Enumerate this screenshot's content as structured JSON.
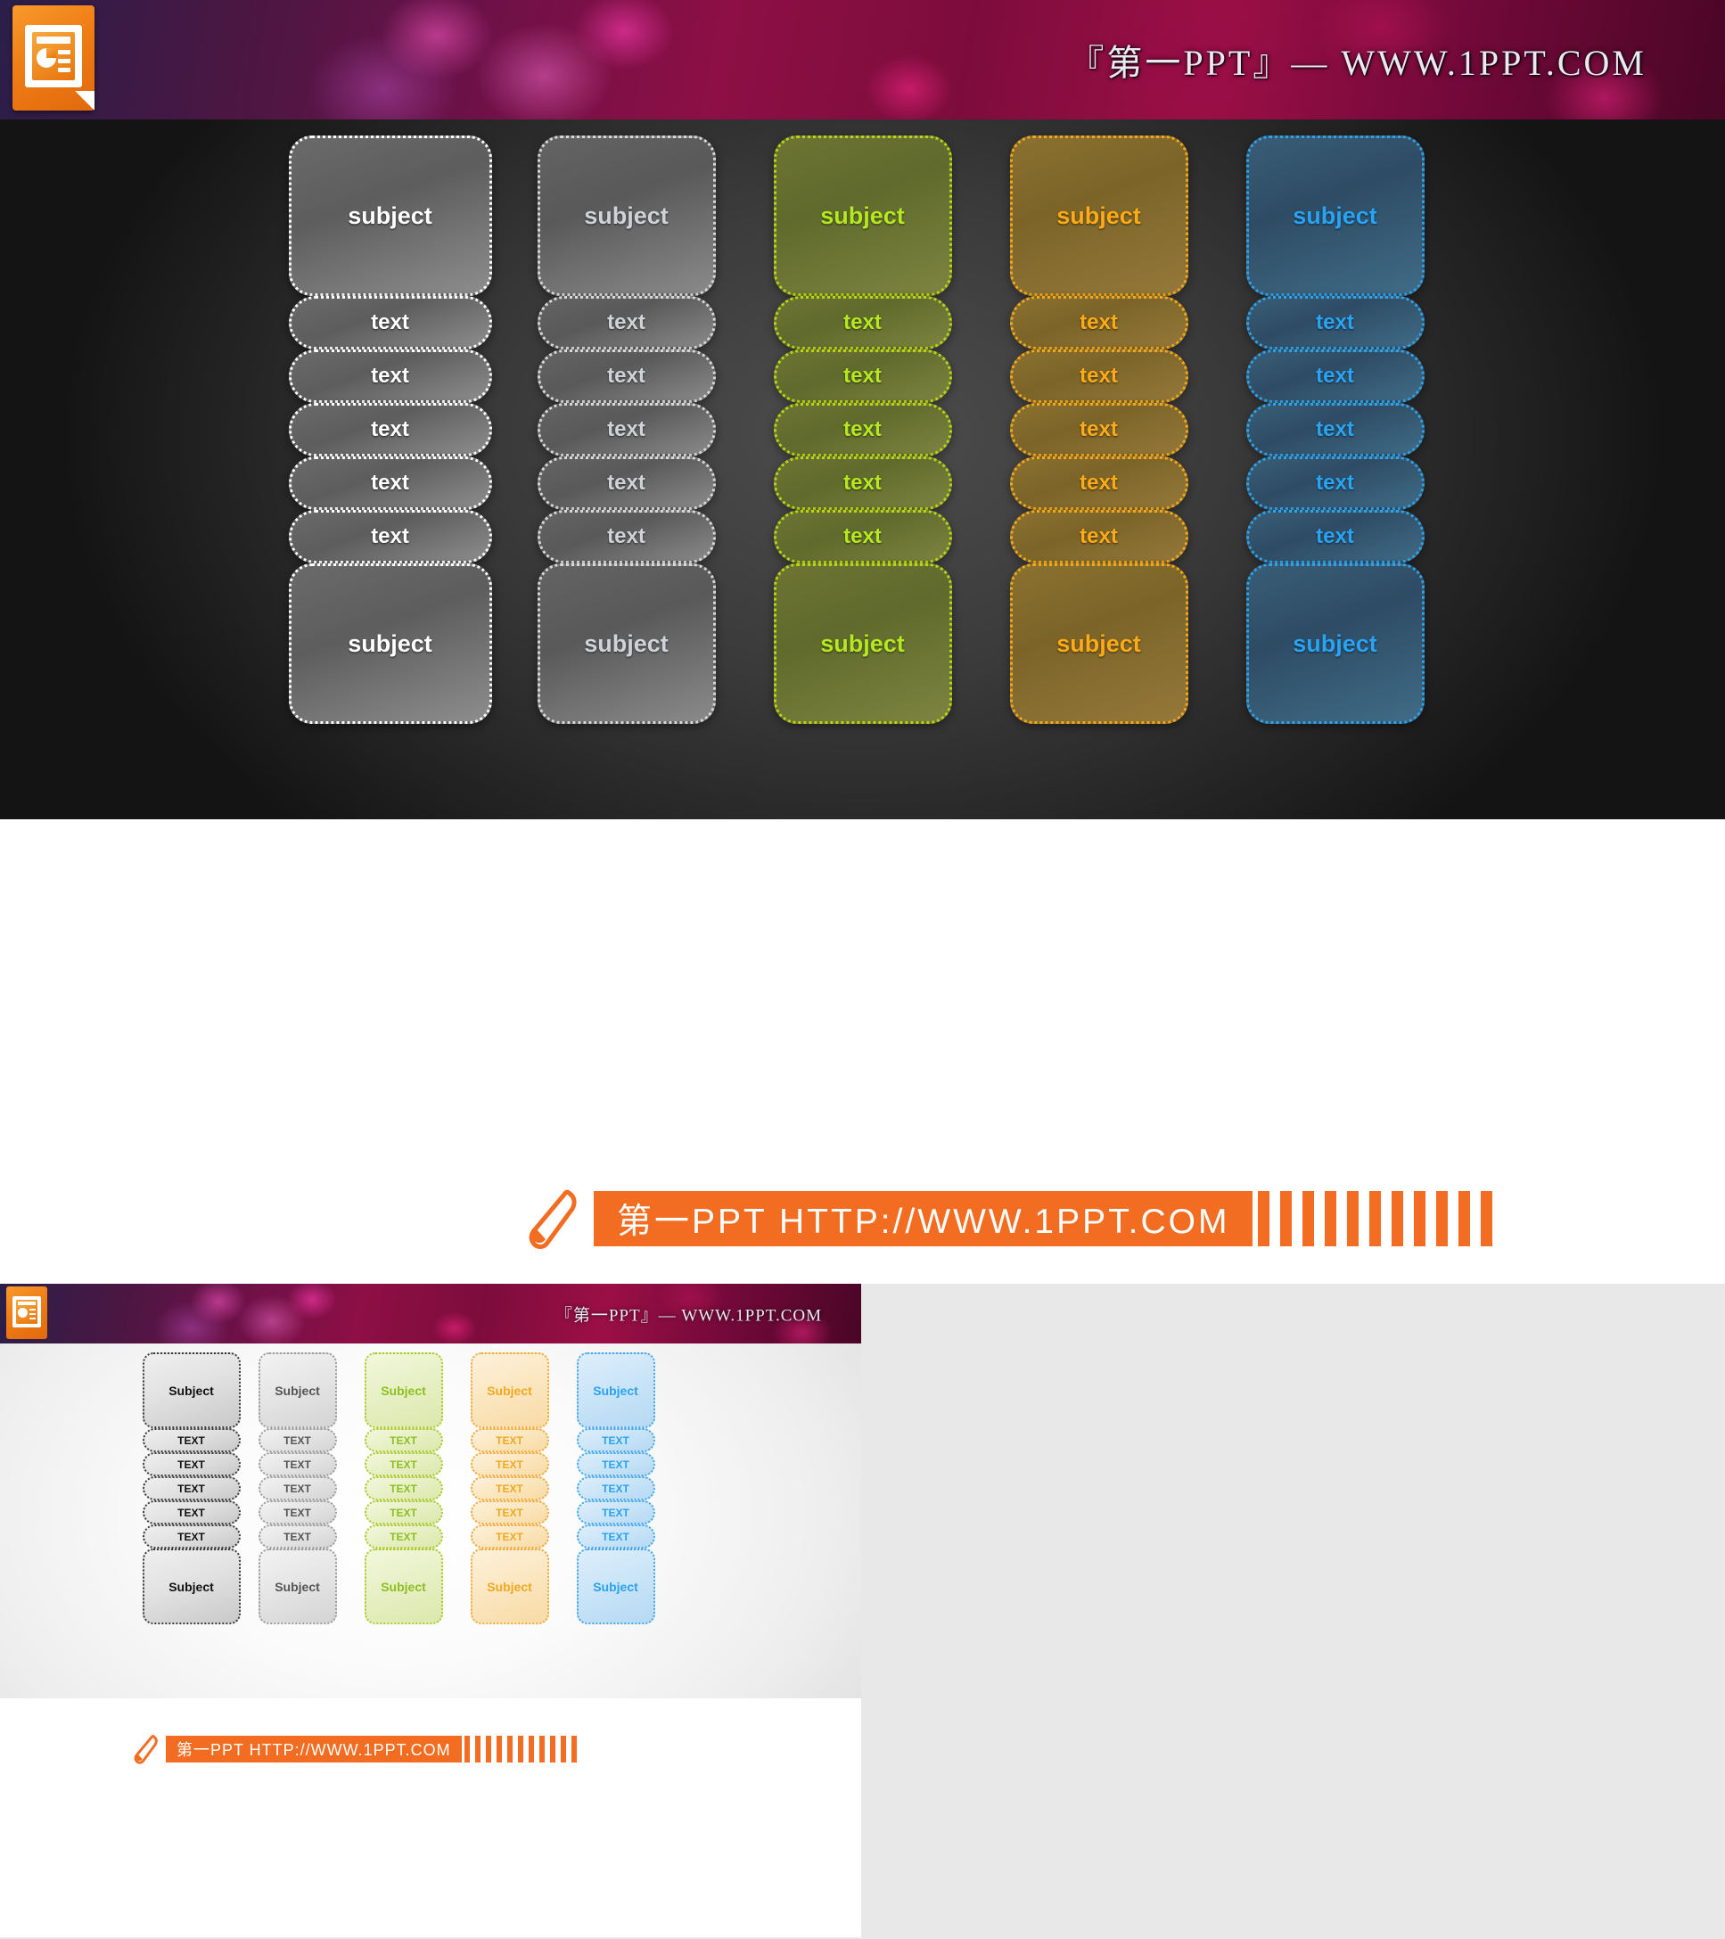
{
  "slide_main": {
    "banner": {
      "logo_icon": "powerpoint-logo-icon",
      "title": "『第一PPT』— WWW.1PPT.COM"
    },
    "grid": {
      "columns": [
        {
          "key": "gray1",
          "theme": "t-gray1",
          "narrow": false
        },
        {
          "key": "gray2",
          "theme": "t-gray2",
          "narrow": true
        },
        {
          "key": "green",
          "theme": "t-green",
          "narrow": true
        },
        {
          "key": "orange",
          "theme": "t-orange",
          "narrow": true
        },
        {
          "key": "blue",
          "theme": "t-blue",
          "narrow": true
        }
      ],
      "rows": [
        {
          "type": "subject",
          "labels": [
            "subject",
            "subject",
            "subject",
            "subject",
            "subject"
          ]
        },
        {
          "type": "text",
          "labels": [
            "text",
            "text",
            "text",
            "text",
            "text"
          ]
        },
        {
          "type": "text",
          "labels": [
            "text",
            "text",
            "text",
            "text",
            "text"
          ]
        },
        {
          "type": "text",
          "labels": [
            "text",
            "text",
            "text",
            "text",
            "text"
          ]
        },
        {
          "type": "text",
          "labels": [
            "text",
            "text",
            "text",
            "text",
            "text"
          ]
        },
        {
          "type": "text",
          "labels": [
            "text",
            "text",
            "text",
            "text",
            "text"
          ]
        },
        {
          "type": "subject",
          "labels": [
            "subject",
            "subject",
            "subject",
            "subject",
            "subject"
          ]
        }
      ]
    },
    "footer": {
      "pen_icon": "pen-icon",
      "text": "第一PPT HTTP://WWW.1PPT.COM",
      "stripe_count": 11
    }
  },
  "slide_thumb": {
    "banner": {
      "logo_icon": "powerpoint-logo-icon",
      "title": "『第一PPT』— WWW.1PPT.COM"
    },
    "grid": {
      "columns": [
        {
          "key": "gray1",
          "theme": "lt-gray1",
          "narrow": false
        },
        {
          "key": "gray2",
          "theme": "lt-gray2",
          "narrow": true
        },
        {
          "key": "green",
          "theme": "lt-green",
          "narrow": true
        },
        {
          "key": "orange",
          "theme": "lt-orange",
          "narrow": true
        },
        {
          "key": "blue",
          "theme": "lt-blue",
          "narrow": true
        }
      ],
      "rows": [
        {
          "type": "subject",
          "labels": [
            "Subject",
            "Subject",
            "Subject",
            "Subject",
            "Subject"
          ]
        },
        {
          "type": "text",
          "labels": [
            "TEXT",
            "TEXT",
            "TEXT",
            "TEXT",
            "TEXT"
          ]
        },
        {
          "type": "text",
          "labels": [
            "TEXT",
            "TEXT",
            "TEXT",
            "TEXT",
            "TEXT"
          ]
        },
        {
          "type": "text",
          "labels": [
            "TEXT",
            "TEXT",
            "TEXT",
            "TEXT",
            "TEXT"
          ]
        },
        {
          "type": "text",
          "labels": [
            "TEXT",
            "TEXT",
            "TEXT",
            "TEXT",
            "TEXT"
          ]
        },
        {
          "type": "text",
          "labels": [
            "TEXT",
            "TEXT",
            "TEXT",
            "TEXT",
            "TEXT"
          ]
        },
        {
          "type": "subject",
          "labels": [
            "Subject",
            "Subject",
            "Subject",
            "Subject",
            "Subject"
          ]
        }
      ]
    },
    "footer": {
      "pen_icon": "pen-icon",
      "text": "第一PPT HTTP://WWW.1PPT.COM",
      "stripe_count": 11
    }
  },
  "colors": {
    "accent_orange": "#f26d21",
    "green": "#b5e820",
    "orange": "#ffab17",
    "blue": "#29a3f4",
    "banner_magenta": "#8d0f45",
    "dark_bg": "#3a3a3a"
  }
}
